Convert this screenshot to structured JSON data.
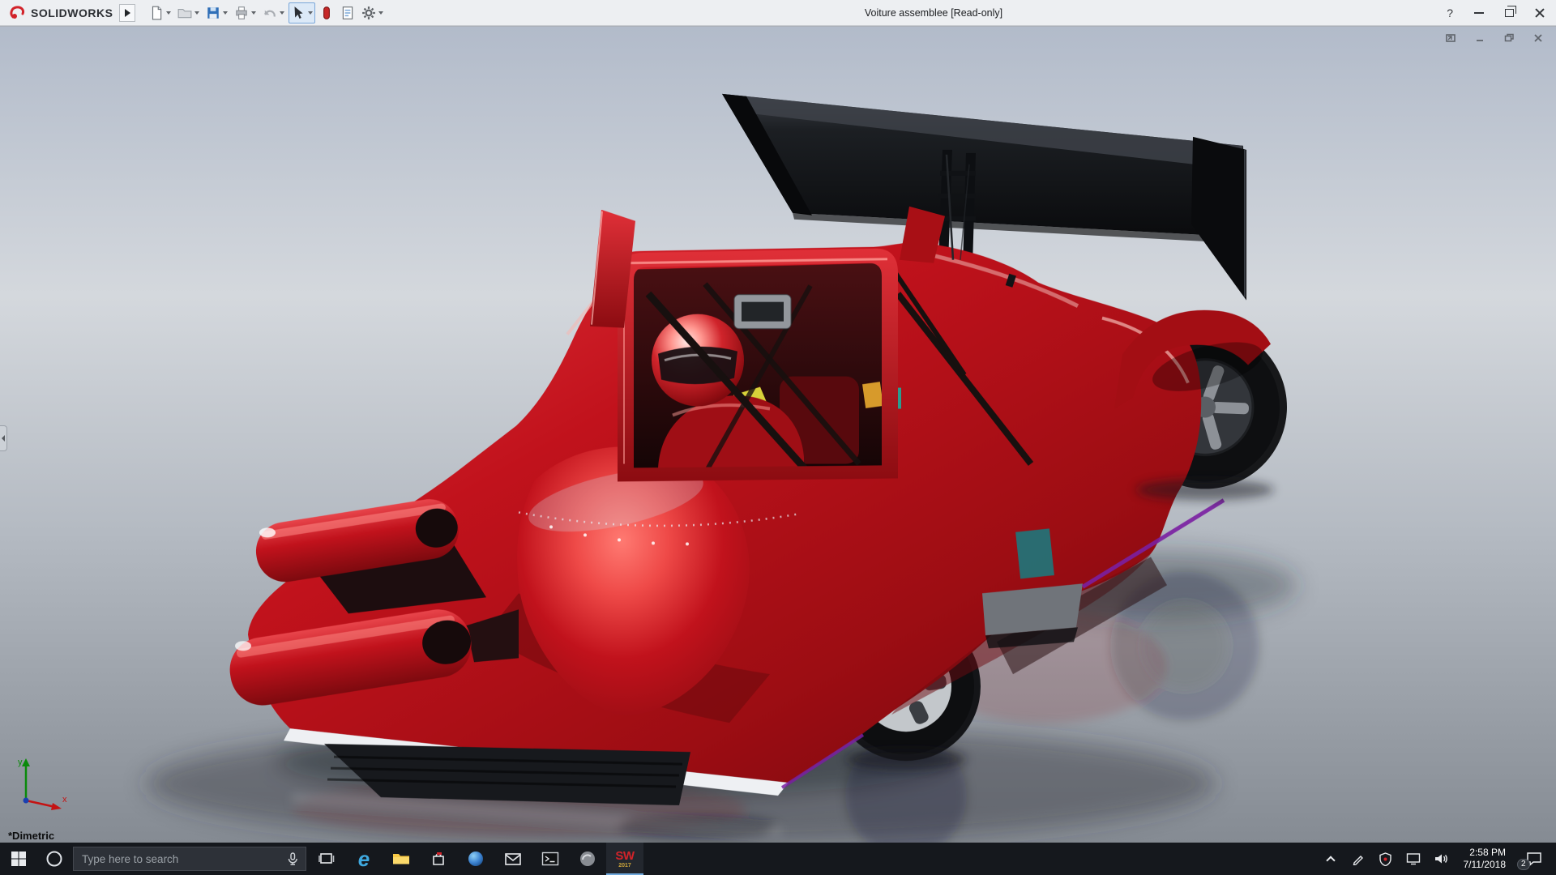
{
  "colors": {
    "titlebar-bg": "#edeff2",
    "titlebar-border": "#c9ccd1",
    "taskbar-bg": "#15181d",
    "search-bg": "#2d3138",
    "search-border": "#43474e",
    "select-accent": "#7aa7d9",
    "solidworks-red": "#d2232a",
    "car-red": "#c1121c",
    "wing-black": "#101114",
    "viewport-top": "#b2bbca",
    "viewport-bottom": "#858b93",
    "text-light": "#e8eaed",
    "text-muted": "#9aa0a6"
  },
  "titlebar": {
    "title": "Voiture assemblee [Read-only]",
    "logo_text": "SOLIDWORKS",
    "help_label": "?",
    "toolbar_icons": [
      "new-document",
      "open",
      "save",
      "print",
      "undo",
      "select",
      "rebuild",
      "file-properties",
      "options"
    ],
    "window_controls": [
      "help",
      "minimize",
      "maximize",
      "close"
    ]
  },
  "viewport": {
    "view_label": "*Dimetric",
    "doc_controls": [
      "float-window",
      "minimize",
      "restore",
      "close"
    ],
    "triad": {
      "x_label": "x",
      "y_label": "y"
    },
    "model": "red prototype race car assembly with rear wing, 3D shaded view with floor reflection"
  },
  "taskbar": {
    "search_placeholder": "Type here to search",
    "apps": [
      "start",
      "cortana-search",
      "task-view",
      "edge",
      "file-explorer",
      "store",
      "browser-sphere",
      "mail",
      "terminal",
      "gray-circle-app",
      "solidworks-2017"
    ],
    "edge_letter": "e",
    "solidworks_label": "SW",
    "solidworks_year": "2017",
    "tray": {
      "icons": [
        "chevron-up",
        "pen",
        "defender",
        "display",
        "volume"
      ],
      "time": "2:58 PM",
      "date": "7/11/2018",
      "notification_count": "2"
    }
  }
}
